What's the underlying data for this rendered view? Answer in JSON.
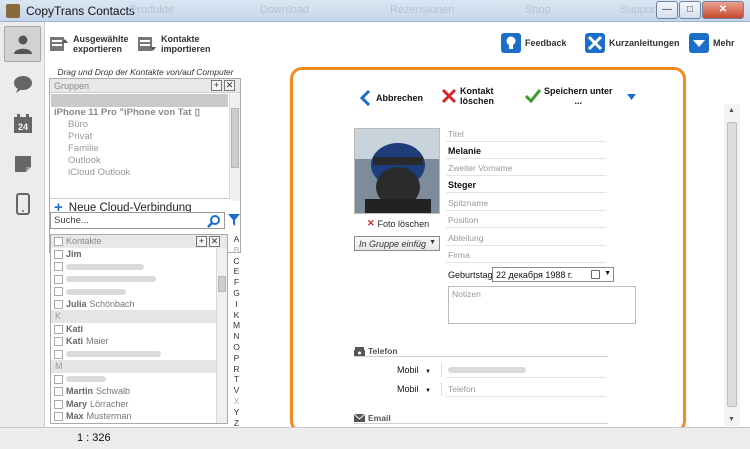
{
  "window": {
    "title": "CopyTrans Contacts",
    "bg_menu": [
      "Produkte",
      "Download",
      "Rezensionen",
      "Shop",
      "Support"
    ],
    "buttons": {
      "minimize": "—",
      "maximize": "□",
      "close": "✕"
    }
  },
  "leftnav": {
    "items": [
      {
        "name": "contacts",
        "icon": "person-icon",
        "active": true
      },
      {
        "name": "messages",
        "icon": "speech-bubble-icon"
      },
      {
        "name": "calendar",
        "icon": "calendar-icon",
        "text": "24"
      },
      {
        "name": "notes",
        "icon": "note-icon"
      },
      {
        "name": "device",
        "icon": "phone-icon"
      }
    ]
  },
  "toolbar": {
    "export_label_1": "Ausgewählte",
    "export_label_2": "exportieren",
    "import_label_1": "Kontakte",
    "import_label_2": "importieren",
    "feedback": "Feedback",
    "guides": "Kurzanleitungen",
    "more": "Mehr"
  },
  "sidebar": {
    "dnd_hint": "Drag und Drop der Kontakte von/auf Computer",
    "groups_header": "Gruppen",
    "device_name": "iPhone 11 Pro \"iPhone von Tat",
    "groups": [
      "Büro",
      "Privat",
      "Familie",
      "Outlook",
      "iCloud Outlook"
    ],
    "cloud_label": "Neue Cloud-Verbindung",
    "search_placeholder": "Suche...",
    "contacts_header": "Kontakte",
    "contacts": [
      {
        "first": "Jim",
        "last": ""
      },
      {
        "blur": 78
      },
      {
        "blur": 90
      },
      {
        "blur": 60
      },
      {
        "first": "Julia",
        "last": "Schönbach"
      },
      {
        "sep": "K"
      },
      {
        "first": "Kati",
        "last": ""
      },
      {
        "first": "Kati",
        "last": "Maier"
      },
      {
        "blur": 95
      },
      {
        "sep": "M"
      },
      {
        "blur": 40
      },
      {
        "first": "Martin",
        "last": "Schwalb"
      },
      {
        "first": "Mary",
        "last": "Lörracher"
      },
      {
        "first": "Max",
        "last": "Musterman"
      }
    ],
    "alphabet": [
      "A",
      "B",
      "C",
      "E",
      "F",
      "G",
      "I",
      "K",
      "M",
      "N",
      "O",
      "P",
      "R",
      "T",
      "V",
      "X",
      "Y",
      "Z",
      "#"
    ],
    "alphabet_dim": [
      "B",
      "X"
    ]
  },
  "editor": {
    "cancel": "Abbrechen",
    "delete_1": "Kontakt",
    "delete_2": "löschen",
    "save_1": "Speichern unter",
    "save_2": "...",
    "delete_photo": "Foto löschen",
    "group_combo": "In Gruppe einfüg",
    "fields": {
      "title_label": "Titel",
      "first_name": "Melanie",
      "middle_label": "Zweiter Vorname",
      "last_name": "Steger",
      "nickname_label": "Spitzname",
      "position_label": "Position",
      "department_label": "Abteilung",
      "company_label": "Firma"
    },
    "birthday_label": "Geburtstag",
    "birthday_value": "22  декабря  1988 г.",
    "notes_placeholder": "Notizen",
    "phone_section": "Telefon",
    "phone_rows": [
      {
        "type": "Mobil",
        "value_hidden": true
      },
      {
        "type": "Mobil",
        "placeholder": "Telefon"
      }
    ],
    "email_section": "Email"
  },
  "status": {
    "count": "1 : 326"
  },
  "colors": {
    "accent_orange": "#f28b1f",
    "link_blue": "#1b6fc9"
  }
}
